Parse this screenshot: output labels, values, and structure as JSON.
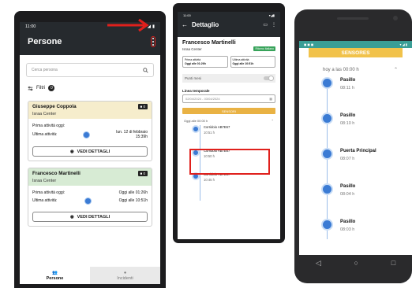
{
  "phone1": {
    "status_time": "11:00",
    "title": "Persone",
    "search_placeholder": "Cerca persona",
    "filters_label": "Filtri",
    "filters_count": "0",
    "cards": [
      {
        "name": "Giuseppe Coppola",
        "location": "Israa Center",
        "tag": "0",
        "first_label": "Prima attività oggi:",
        "first_value": "",
        "last_label": "Ultima attività:",
        "last_value_line1": "lun. 12 di febbraio",
        "last_value_line2": "15:39h",
        "button_label": "VEDI DETTAGLI"
      },
      {
        "name": "Francesco Martinelli",
        "location": "Israa Center",
        "tag": "0",
        "first_label": "Prima attività oggi:",
        "first_value": "Oggi alle 01:26h",
        "last_label": "Ultima attività:",
        "last_value_line1": "Oggi alle 10:51h",
        "last_value_line2": "",
        "button_label": "VEDI DETTAGLI"
      }
    ],
    "nav": [
      {
        "label": "Persone"
      },
      {
        "label": "Incidenti"
      }
    ]
  },
  "phone2": {
    "title": "Dettaglio",
    "person_name": "Francesco Martinelli",
    "location": "Israa Center",
    "status_chip": "Ritorno Italiano",
    "box1_label": "Prima attività",
    "box1_value": "Oggi alle 01:26h",
    "box2_label": "Ultima attività",
    "box2_value": "Oggi alle 10:51h",
    "toggle_label": "Punti mesi",
    "timeline_label": "Linea temporale",
    "date_value": "02/04/2024 - 03/04/2024",
    "sensors_button": "SENSORI",
    "today_label": "Oggi alle 00:00 h",
    "events": [
      {
        "title": "Corridoio AB7E67",
        "time": "10:51 h"
      },
      {
        "title": "Corridoio AB7E67",
        "time": "10:50 h"
      },
      {
        "title": "Corridoio AB7E67",
        "time": "10:45 h"
      }
    ]
  },
  "phone3": {
    "header": "SENSORES",
    "date_label": "hoy a las 00:00 h",
    "events": [
      {
        "title": "Pasillo",
        "time": "08:11 h"
      },
      {
        "title": "Pasillo",
        "time": "08:10 h"
      },
      {
        "title": "Puerta Principal",
        "time": "08:07 h"
      },
      {
        "title": "Pasillo",
        "time": "08:04 h"
      },
      {
        "title": "Pasillo",
        "time": "08:03 h"
      }
    ]
  },
  "colors": {
    "appbar": "#262a2e",
    "highlight": "#e0201c",
    "accent_blue": "#3b7bd4",
    "sensors_yellow": "#f1c24a",
    "card_yellow": "#f6edcc",
    "card_green": "#d7ebd4"
  }
}
